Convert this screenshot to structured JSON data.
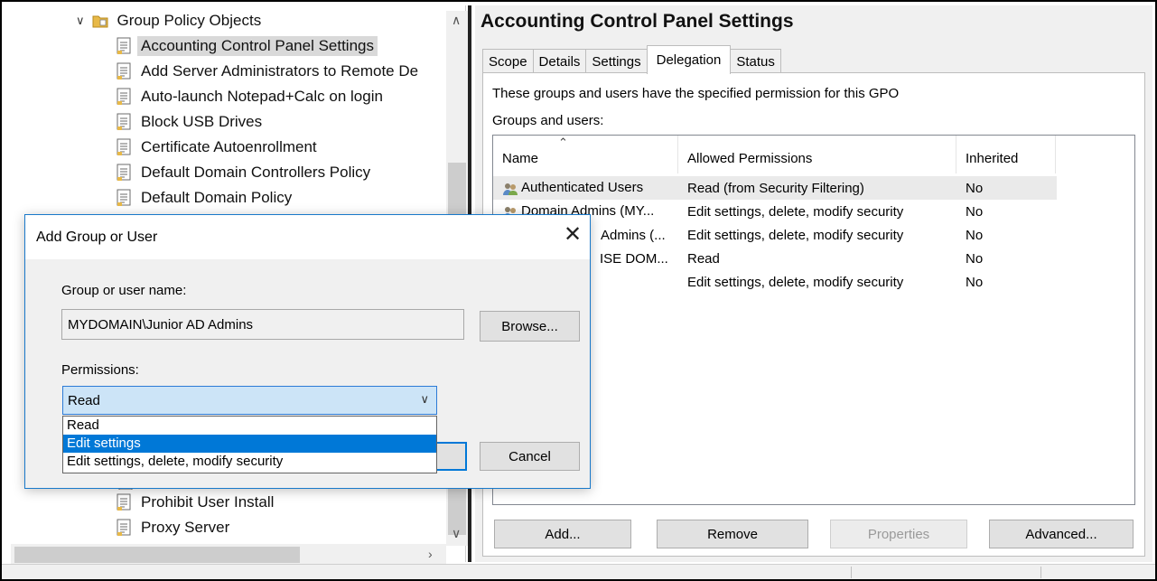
{
  "tree": {
    "root_label": "Group Policy Objects",
    "items": [
      {
        "label": "Accounting Control Panel Settings",
        "selected": true
      },
      {
        "label": "Add Server Administrators to Remote De",
        "selected": false
      },
      {
        "label": "Auto-launch Notepad+Calc on login",
        "selected": false
      },
      {
        "label": "Block USB Drives",
        "selected": false
      },
      {
        "label": "Certificate Autoenrollment",
        "selected": false
      },
      {
        "label": "Default Domain Controllers Policy",
        "selected": false
      },
      {
        "label": "Default Domain Policy",
        "selected": false
      }
    ],
    "bottom_items": [
      {
        "label": "Prohibit User Install"
      },
      {
        "label": "Proxy Server"
      }
    ]
  },
  "gpo": {
    "title": "Accounting Control Panel Settings",
    "tabs": [
      "Scope",
      "Details",
      "Settings",
      "Delegation",
      "Status"
    ],
    "active_tab": "Delegation",
    "description": "These groups and users have the specified permission for this GPO",
    "groups_label": "Groups and users:",
    "columns": [
      "Name",
      "Allowed Permissions",
      "Inherited"
    ],
    "rows": [
      {
        "name": "Authenticated Users",
        "permissions": "Read (from Security Filtering)",
        "inherited": "No",
        "icon": "users-icon"
      },
      {
        "name": "Domain Admins (MY...",
        "permissions": "Edit settings, delete, modify security",
        "inherited": "No",
        "icon": "users-icon"
      },
      {
        "name": "Admins (...",
        "permissions": "Edit settings, delete, modify security",
        "inherited": "No",
        "icon": "users-icon"
      },
      {
        "name": "ISE DOM...",
        "permissions": "Read",
        "inherited": "No",
        "icon": "users-icon"
      },
      {
        "name": "",
        "permissions": "Edit settings, delete, modify security",
        "inherited": "No",
        "icon": ""
      }
    ],
    "buttons": {
      "add": "Add...",
      "remove": "Remove",
      "properties": "Properties",
      "advanced": "Advanced..."
    }
  },
  "dialog": {
    "title": "Add Group or User",
    "name_label": "Group or user name:",
    "name_value": "MYDOMAIN\\Junior AD Admins",
    "browse_label": "Browse...",
    "permissions_label": "Permissions:",
    "selected_permission": "Read",
    "options": [
      "Read",
      "Edit settings",
      "Edit settings, delete, modify security"
    ],
    "hovered_option": "Edit settings",
    "cancel_label": "Cancel"
  },
  "colors": {
    "accent": "#0078d7",
    "dialog_border": "#1979ca",
    "combo_background": "#cce4f7",
    "selection_gray": "#d9d9d9"
  }
}
